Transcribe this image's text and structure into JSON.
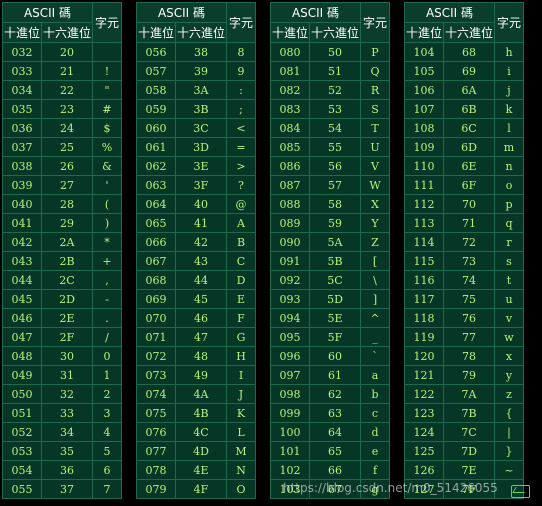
{
  "headers": {
    "ascii": "ASCII 碼",
    "decimal": "十進位",
    "hex": "十六進位",
    "char": "字元"
  },
  "blocks": [
    {
      "rows": [
        [
          "032",
          "20",
          ""
        ],
        [
          "033",
          "21",
          "!"
        ],
        [
          "034",
          "22",
          "\""
        ],
        [
          "035",
          "23",
          "#"
        ],
        [
          "036",
          "24",
          "$"
        ],
        [
          "037",
          "25",
          "%"
        ],
        [
          "038",
          "26",
          "&"
        ],
        [
          "039",
          "27",
          "'"
        ],
        [
          "040",
          "28",
          "("
        ],
        [
          "041",
          "29",
          ")"
        ],
        [
          "042",
          "2A",
          "*"
        ],
        [
          "043",
          "2B",
          "+"
        ],
        [
          "044",
          "2C",
          ","
        ],
        [
          "045",
          "2D",
          "-"
        ],
        [
          "046",
          "2E",
          "."
        ],
        [
          "047",
          "2F",
          "/"
        ],
        [
          "048",
          "30",
          "0"
        ],
        [
          "049",
          "31",
          "1"
        ],
        [
          "050",
          "32",
          "2"
        ],
        [
          "051",
          "33",
          "3"
        ],
        [
          "052",
          "34",
          "4"
        ],
        [
          "053",
          "35",
          "5"
        ],
        [
          "054",
          "36",
          "6"
        ],
        [
          "055",
          "37",
          "7"
        ]
      ]
    },
    {
      "rows": [
        [
          "056",
          "38",
          "8"
        ],
        [
          "057",
          "39",
          "9"
        ],
        [
          "058",
          "3A",
          ":"
        ],
        [
          "059",
          "3B",
          ";"
        ],
        [
          "060",
          "3C",
          "<"
        ],
        [
          "061",
          "3D",
          "="
        ],
        [
          "062",
          "3E",
          ">"
        ],
        [
          "063",
          "3F",
          "?"
        ],
        [
          "064",
          "40",
          "@"
        ],
        [
          "065",
          "41",
          "A"
        ],
        [
          "066",
          "42",
          "B"
        ],
        [
          "067",
          "43",
          "C"
        ],
        [
          "068",
          "44",
          "D"
        ],
        [
          "069",
          "45",
          "E"
        ],
        [
          "070",
          "46",
          "F"
        ],
        [
          "071",
          "47",
          "G"
        ],
        [
          "072",
          "48",
          "H"
        ],
        [
          "073",
          "49",
          "I"
        ],
        [
          "074",
          "4A",
          "J"
        ],
        [
          "075",
          "4B",
          "K"
        ],
        [
          "076",
          "4C",
          "L"
        ],
        [
          "077",
          "4D",
          "M"
        ],
        [
          "078",
          "4E",
          "N"
        ],
        [
          "079",
          "4F",
          "O"
        ]
      ]
    },
    {
      "rows": [
        [
          "080",
          "50",
          "P"
        ],
        [
          "081",
          "51",
          "Q"
        ],
        [
          "082",
          "52",
          "R"
        ],
        [
          "083",
          "53",
          "S"
        ],
        [
          "084",
          "54",
          "T"
        ],
        [
          "085",
          "55",
          "U"
        ],
        [
          "086",
          "56",
          "V"
        ],
        [
          "087",
          "57",
          "W"
        ],
        [
          "088",
          "58",
          "X"
        ],
        [
          "089",
          "59",
          "Y"
        ],
        [
          "090",
          "5A",
          "Z"
        ],
        [
          "091",
          "5B",
          "["
        ],
        [
          "092",
          "5C",
          "\\"
        ],
        [
          "093",
          "5D",
          "]"
        ],
        [
          "094",
          "5E",
          "^"
        ],
        [
          "095",
          "5F",
          "_"
        ],
        [
          "096",
          "60",
          "`"
        ],
        [
          "097",
          "61",
          "a"
        ],
        [
          "098",
          "62",
          "b"
        ],
        [
          "099",
          "63",
          "c"
        ],
        [
          "100",
          "64",
          "d"
        ],
        [
          "101",
          "65",
          "e"
        ],
        [
          "102",
          "66",
          "f"
        ],
        [
          "103",
          "67",
          "g"
        ]
      ]
    },
    {
      "rows": [
        [
          "104",
          "68",
          "h"
        ],
        [
          "105",
          "69",
          "i"
        ],
        [
          "106",
          "6A",
          "j"
        ],
        [
          "107",
          "6B",
          "k"
        ],
        [
          "108",
          "6C",
          "l"
        ],
        [
          "109",
          "6D",
          "m"
        ],
        [
          "110",
          "6E",
          "n"
        ],
        [
          "111",
          "6F",
          "o"
        ],
        [
          "112",
          "70",
          "p"
        ],
        [
          "113",
          "71",
          "q"
        ],
        [
          "114",
          "72",
          "r"
        ],
        [
          "115",
          "73",
          "s"
        ],
        [
          "116",
          "74",
          "t"
        ],
        [
          "117",
          "75",
          "u"
        ],
        [
          "118",
          "76",
          "v"
        ],
        [
          "119",
          "77",
          "w"
        ],
        [
          "120",
          "78",
          "x"
        ],
        [
          "121",
          "79",
          "y"
        ],
        [
          "122",
          "7A",
          "z"
        ],
        [
          "123",
          "7B",
          "{"
        ],
        [
          "124",
          "7C",
          "|"
        ],
        [
          "125",
          "7D",
          "}"
        ],
        [
          "126",
          "7E",
          "~"
        ],
        [
          "127",
          "7F",
          ""
        ]
      ]
    }
  ],
  "watermark": "https://blog.csdn.net/m0_51426055",
  "icons": {
    "corner": "image-frame-icon"
  },
  "colors": {
    "background": "#000000",
    "grid": "#1e6a4c",
    "header_bg": "#0b3d2c",
    "cell_bg": "#063726",
    "cell_text": "#b5f37c"
  }
}
